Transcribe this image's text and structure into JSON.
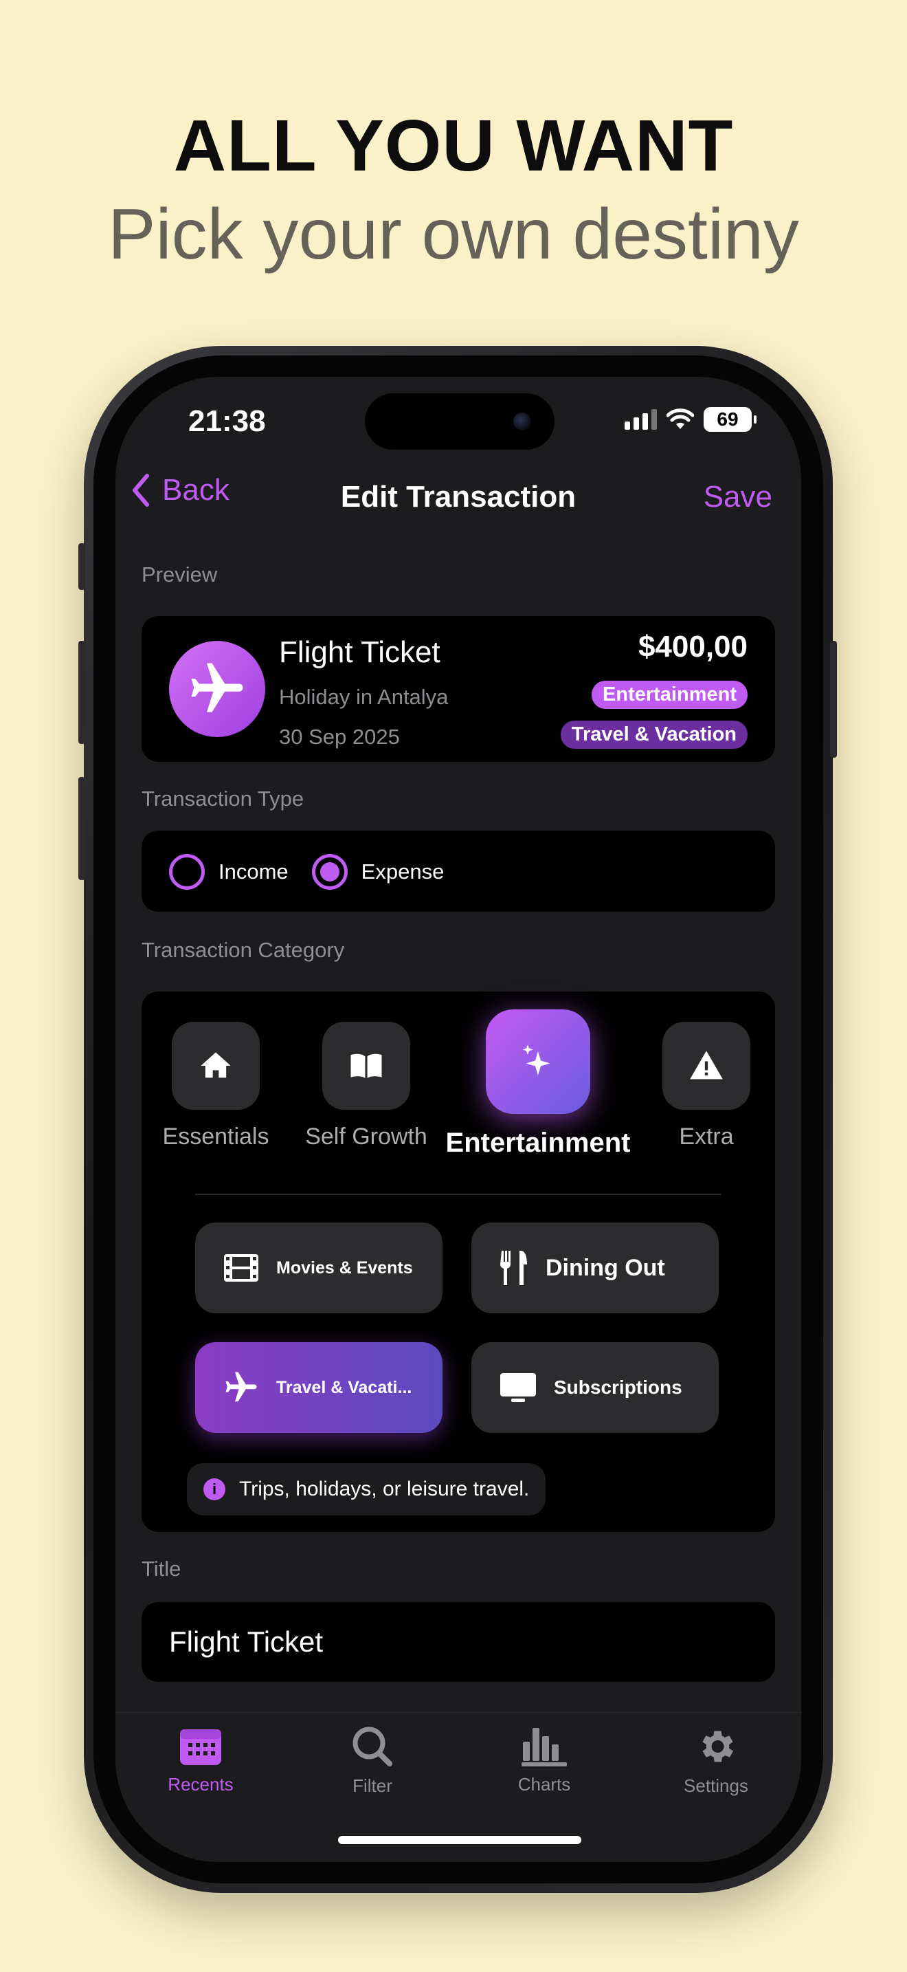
{
  "headline": "ALL YOU WANT",
  "subline": "Pick your own destiny",
  "status": {
    "time": "21:38",
    "battery": "69"
  },
  "nav": {
    "back": "Back",
    "title": "Edit Transaction",
    "save": "Save"
  },
  "preview": {
    "label": "Preview",
    "title": "Flight Ticket",
    "subtitle": "Holiday in Antalya",
    "date": "30 Sep 2025",
    "amount": "$400,00",
    "tags": [
      "Entertainment",
      "Travel & Vacation"
    ],
    "icon": "airplane-icon"
  },
  "type": {
    "label": "Transaction Type",
    "options": [
      "Income",
      "Expense"
    ],
    "selected": "Expense"
  },
  "category": {
    "label": "Transaction Category",
    "items": [
      {
        "label": "Essentials",
        "icon": "house-icon"
      },
      {
        "label": "Self Growth",
        "icon": "book-icon"
      },
      {
        "label": "Entertainment",
        "icon": "sparkles-icon"
      },
      {
        "label": "Extra",
        "icon": "warning-icon"
      }
    ],
    "selected": "Entertainment",
    "subcategories": [
      {
        "label": "Movies & Events",
        "icon": "film-icon"
      },
      {
        "label": "Dining Out",
        "icon": "fork-knife-icon"
      },
      {
        "label": "Travel & Vacati...",
        "icon": "airplane-icon"
      },
      {
        "label": "Subscriptions",
        "icon": "tv-icon"
      }
    ],
    "selected_sub": "Travel & Vacati...",
    "hint": "Trips, holidays, or leisure travel."
  },
  "title_field": {
    "label": "Title",
    "value": "Flight Ticket"
  },
  "tabs": [
    {
      "label": "Recents",
      "icon": "calendar-icon"
    },
    {
      "label": "Filter",
      "icon": "search-icon"
    },
    {
      "label": "Charts",
      "icon": "bar-chart-icon"
    },
    {
      "label": "Settings",
      "icon": "gear-icon"
    }
  ],
  "colors": {
    "accent": "#bf5af2",
    "background": "#fbf1c8",
    "screen": "#1c1c1e"
  }
}
